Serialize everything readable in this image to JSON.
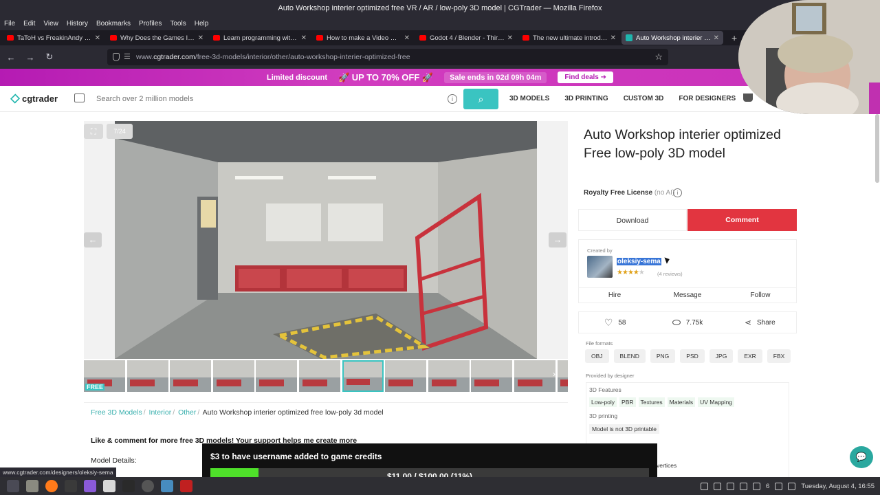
{
  "window": {
    "title": "Auto Workshop interier optimized free VR / AR / low-poly 3D model | CGTrader — Mozilla Firefox"
  },
  "menu": [
    "File",
    "Edit",
    "View",
    "History",
    "Bookmarks",
    "Profiles",
    "Tools",
    "Help"
  ],
  "tabs": [
    {
      "label": "TaToH vs FreakinAndy & Jon",
      "icon": "youtube-icon",
      "active": false
    },
    {
      "label": "Why Does the Games Indust",
      "icon": "youtube-icon",
      "active": false
    },
    {
      "label": "Learn programming with C",
      "icon": "youtube-icon",
      "active": false
    },
    {
      "label": "How to make a Video Game",
      "icon": "youtube-icon",
      "active": false
    },
    {
      "label": "Godot 4 / Blender - Third Pe",
      "icon": "youtube-icon",
      "active": false
    },
    {
      "label": "The new ultimate introducti",
      "icon": "youtube-icon",
      "active": false
    },
    {
      "label": "Auto Workshop interier opti",
      "icon": "cgtrader-icon",
      "active": true
    }
  ],
  "url": {
    "scheme": "www.",
    "host": "cgtrader.com",
    "path": "/free-3d-models/interior/other/auto-workshop-interier-optimized-free"
  },
  "promo": {
    "limited": "Limited discount",
    "offer": "🚀 UP TO 70% OFF 🚀",
    "sale_ends": "Sale ends in",
    "countdown": "02d 09h 04m",
    "find_deals": "Find deals ➔"
  },
  "header": {
    "logo": "cgtrader",
    "search_placeholder": "Search over 2 million models",
    "nav": [
      "3D MODELS",
      "3D PRINTING",
      "CUSTOM 3D",
      "FOR DESIGNERS"
    ]
  },
  "gallery": {
    "counter": "7/24",
    "thumb_badge": "FREE",
    "thumb_count": 12,
    "active_thumb": 6
  },
  "breadcrumb": {
    "items": [
      "Free 3D Models",
      "Interior",
      "Other"
    ],
    "current": "Auto Workshop interier optimized free low-poly 3d model"
  },
  "description": {
    "bold": "Like & comment for more free 3D models! Your support helps me create more",
    "details_label": "Model Details:"
  },
  "product": {
    "title": "Auto Workshop interier optimized Free low-poly 3D model",
    "license": "Royalty Free License",
    "license_note": "(no AI)",
    "download": "Download",
    "comment": "Comment",
    "created_by": "Created by",
    "author": "oleksiy-sema",
    "rating": 4,
    "reviews": "(4 reviews)",
    "actions": [
      "Hire",
      "Message",
      "Follow"
    ],
    "likes": "58",
    "views": "7.75k",
    "share": "Share",
    "file_formats_label": "File formats",
    "formats": [
      "OBJ",
      "BLEND",
      "PNG",
      "PSD",
      "JPG",
      "EXR",
      "FBX"
    ],
    "provided_label": "Provided by designer",
    "features_label": "3D Features",
    "features": [
      "Low-poly",
      "PBR",
      "Textures",
      "Materials",
      "UV Mapping"
    ],
    "printing_label": "3D printing",
    "printing_value": "Model is not 3D printable",
    "vertices": "vertices"
  },
  "status_url": "www.cgtrader.com/designers/oleksiy-sema",
  "donation": {
    "title": "$3 to have username added to game credits",
    "progress_text": "$11.00 / $100.00 (11%)",
    "progress": 0.11
  },
  "taskbar": {
    "clock": "Tuesday, August  4, 16:55",
    "tray_count": "6"
  },
  "colors": {
    "accent": "#3ac4c1",
    "comment": "#e23540",
    "promo": "#c82fb9",
    "progress": "#4fe02a"
  }
}
